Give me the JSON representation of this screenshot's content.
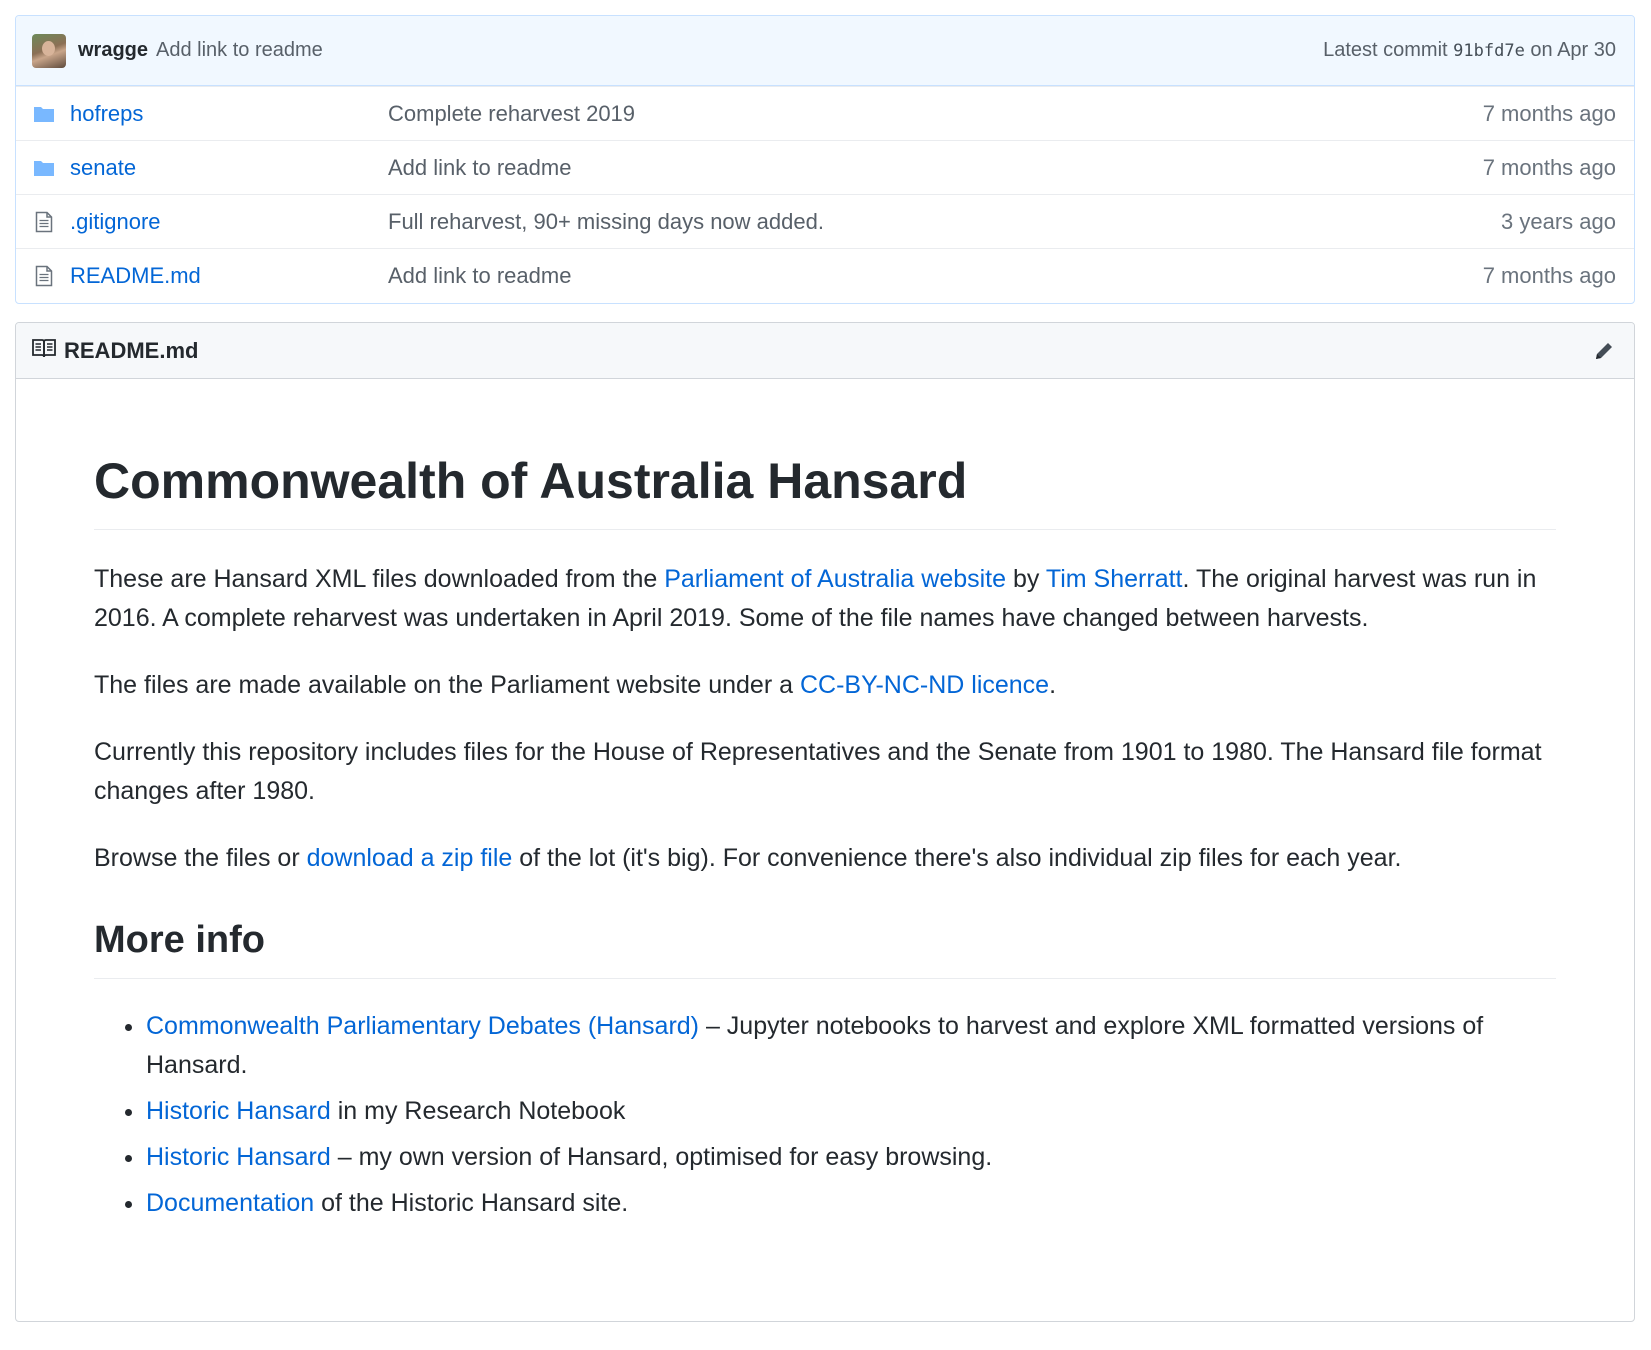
{
  "commit": {
    "author": "wragge",
    "message": "Add link to readme",
    "prefix": "Latest commit",
    "sha": "91bfd7e",
    "date": "on Apr 30"
  },
  "files": [
    {
      "name": "hofreps",
      "type": "folder",
      "commit": "Complete reharvest 2019",
      "age": "7 months ago"
    },
    {
      "name": "senate",
      "type": "folder",
      "commit": "Add link to readme",
      "age": "7 months ago"
    },
    {
      "name": ".gitignore",
      "type": "file",
      "commit": "Full reharvest, 90+ missing days now added.",
      "age": "3 years ago"
    },
    {
      "name": "README.md",
      "type": "file",
      "commit": "Add link to readme",
      "age": "7 months ago"
    }
  ],
  "readme": {
    "filename": "README.md",
    "h1": "Commonwealth of Australia Hansard",
    "p1": {
      "t1": "These are Hansard XML files downloaded from the ",
      "link1": "Parliament of Australia website",
      "t2": " by ",
      "link2": "Tim Sherratt",
      "t3": ". The original harvest was run in 2016. A complete reharvest was undertaken in April 2019. Some of the file names have changed between harvests."
    },
    "p2": {
      "t1": "The files are made available on the Parliament website under a ",
      "link1": "CC-BY-NC-ND licence",
      "t2": "."
    },
    "p3": "Currently this repository includes files for the House of Representatives and the Senate from 1901 to 1980. The Hansard file format changes after 1980.",
    "p4": {
      "t1": "Browse the files or ",
      "link1": "download a zip file",
      "t2": " of the lot (it's big). For convenience there's also individual zip files for each year."
    },
    "h2": "More info",
    "list": [
      {
        "link": "Commonwealth Parliamentary Debates (Hansard)",
        "text": " – Jupyter notebooks to harvest and explore XML formatted versions of Hansard."
      },
      {
        "link": "Historic Hansard",
        "text": " in my Research Notebook"
      },
      {
        "link": "Historic Hansard",
        "text": " – my own version of Hansard, optimised for easy browsing."
      },
      {
        "link": "Documentation",
        "text": " of the Historic Hansard site."
      }
    ]
  },
  "icons": {
    "folder": "folder-icon",
    "file": "file-icon",
    "book": "book-icon",
    "edit": "pencil-icon"
  },
  "colors": {
    "link": "#0366d6",
    "commit_bg": "#f1f8ff",
    "folder": "#79b8ff"
  }
}
